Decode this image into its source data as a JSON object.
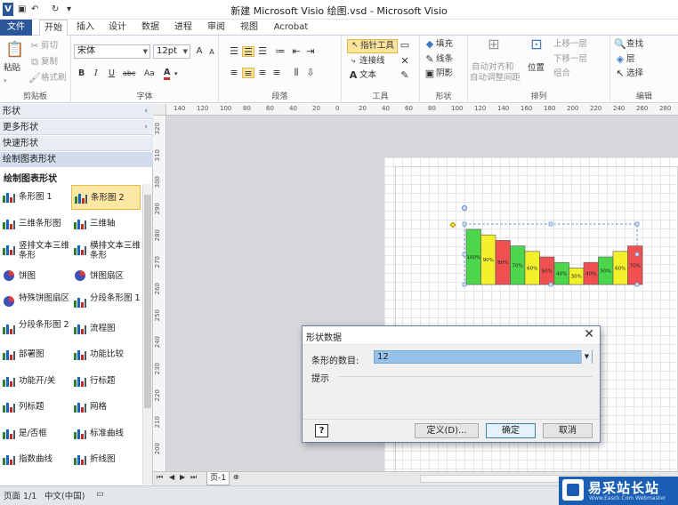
{
  "titlebar": {
    "title": "新建 Microsoft Visio 绘图.vsd - Microsoft Visio",
    "qa_icons": [
      "visio-logo",
      "save-icon",
      "undo-icon",
      "redo-icon",
      "customize-icon"
    ]
  },
  "tabs": [
    "文件",
    "开始",
    "插入",
    "设计",
    "数据",
    "进程",
    "审阅",
    "视图",
    "Acrobat"
  ],
  "ribbon": {
    "clipboard": {
      "label": "剪贴板",
      "paste": "粘贴",
      "cut": "剪切",
      "copy": "复制",
      "format_painter": "格式刷"
    },
    "font": {
      "label": "字体",
      "font_name": "宋体",
      "font_size": "12pt",
      "bold": "B",
      "italic": "I",
      "underline": "U",
      "strike": "abc",
      "case": "Aa",
      "font_color": "A"
    },
    "paragraph": {
      "label": "段落"
    },
    "tools": {
      "label": "工具",
      "pointer": "指针工具",
      "connector": "连接线",
      "text": "文本"
    },
    "shape": {
      "label": "形状",
      "fill": "填充",
      "line": "线条",
      "shadow": "阴影"
    },
    "arrange": {
      "label": "排列",
      "auto_align": "自动对齐和",
      "auto_space": "自动调整间距",
      "position": "位置",
      "bring_forward": "上移一层",
      "send_backward": "下移一层",
      "group": "组合"
    },
    "editing": {
      "label": "编辑",
      "find": "查找",
      "layers": "层",
      "select": "选择"
    }
  },
  "pane": {
    "headers": [
      "形状",
      "更多形状",
      "快速形状",
      "绘制图表形状"
    ],
    "stencil_title": "绘制图表形状",
    "shapes": [
      {
        "name": "条形图 1"
      },
      {
        "name": "条形图 2"
      },
      {
        "name": "三维条形图"
      },
      {
        "name": "三维轴"
      },
      {
        "name": "竖排文本三维条形"
      },
      {
        "name": "横排文本三维条形"
      },
      {
        "name": "饼图"
      },
      {
        "name": "饼图扇区"
      },
      {
        "name": "特殊饼图扇区"
      },
      {
        "name": "分段条形图 1"
      },
      {
        "name": "分段条形图 2"
      },
      {
        "name": "流程图"
      },
      {
        "name": "部署图"
      },
      {
        "name": "功能比较"
      },
      {
        "name": "功能开/关"
      },
      {
        "name": "行标题"
      },
      {
        "name": "列标题"
      },
      {
        "name": "网格"
      },
      {
        "name": "是/否框"
      },
      {
        "name": "标准曲线"
      },
      {
        "name": "指数曲线"
      },
      {
        "name": "折线图"
      }
    ]
  },
  "ruler": {
    "h_ticks": [
      "140",
      "120",
      "100",
      "80",
      "60",
      "40",
      "20",
      "0",
      "20",
      "40",
      "60",
      "80",
      "100",
      "120",
      "140",
      "160",
      "180",
      "200",
      "220",
      "240",
      "260",
      "280"
    ],
    "v_ticks": [
      "320",
      "310",
      "300",
      "290",
      "280",
      "270",
      "260",
      "250",
      "240",
      "230",
      "220",
      "210",
      "200"
    ]
  },
  "chart": {
    "colors": [
      "#4cd64c",
      "#f3f02c",
      "#f05050",
      "#4cd64c",
      "#f3f02c",
      "#f05050",
      "#4cd64c",
      "#f3f02c",
      "#f05050",
      "#4cd64c",
      "#f3f02c",
      "#f05050"
    ],
    "labels": [
      "100%",
      "90%",
      "80%",
      "70%",
      "60%",
      "50%",
      "40%",
      "30%",
      "40%",
      "50%",
      "60%",
      "70%"
    ],
    "values": [
      100,
      90,
      80,
      70,
      60,
      50,
      40,
      30,
      40,
      50,
      60,
      70
    ]
  },
  "dialog": {
    "title": "形状数据",
    "count_label": "条形的数目:",
    "count_value": "12",
    "hint_label": "提示",
    "help": "?",
    "define": "定义(D)...",
    "ok": "确定",
    "cancel": "取消"
  },
  "pagebar": {
    "page_tab": "页-1"
  },
  "status": {
    "page": "页面 1/1",
    "language": "中文(中国)"
  },
  "watermark": {
    "text": "易采站长站",
    "sub": "Www.Easck.Com Webmaster"
  }
}
